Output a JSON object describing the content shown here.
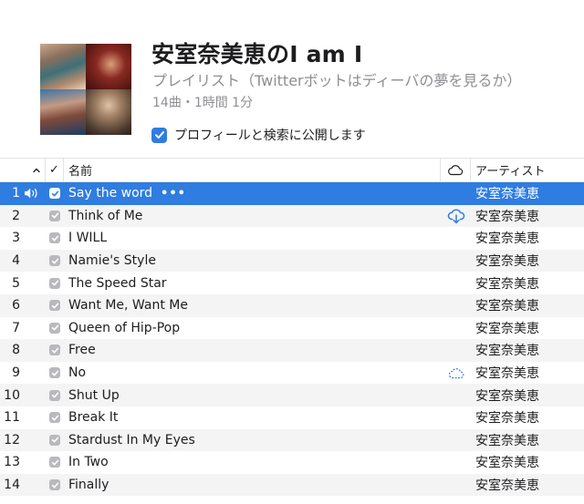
{
  "playlist": {
    "title": "安室奈美恵のI am I",
    "subtitle": "プレイリスト（Twitterボットはディーバの夢を見るか）",
    "meta": "14曲・1時間 1分",
    "publish_label": "プロフィールと検索に公開します",
    "publish_checked": true
  },
  "columns": {
    "sort": "^",
    "check": "✓",
    "name": "名前",
    "cloud": "cloud-icon",
    "artist": "アーティスト"
  },
  "colors": {
    "accent": "#2f7de1",
    "selected_row": "#2f7de1",
    "alt_row": "#f4f4f5",
    "secondary_text": "#8e8e93"
  },
  "tracks": [
    {
      "num": "1",
      "name": "Say the word",
      "artist": "安室奈美恵",
      "selected": true,
      "playing": true,
      "more": "•••"
    },
    {
      "num": "2",
      "name": "Think of Me",
      "artist": "安室奈美恵",
      "cloud": "cloud-download-icon"
    },
    {
      "num": "3",
      "name": "I WILL",
      "artist": "安室奈美恵"
    },
    {
      "num": "4",
      "name": "Namie's Style",
      "artist": "安室奈美恵"
    },
    {
      "num": "5",
      "name": "The Speed Star",
      "artist": "安室奈美恵"
    },
    {
      "num": "6",
      "name": "Want Me, Want Me",
      "artist": "安室奈美恵"
    },
    {
      "num": "7",
      "name": "Queen of Hip-Pop",
      "artist": "安室奈美恵"
    },
    {
      "num": "8",
      "name": "Free",
      "artist": "安室奈美恵"
    },
    {
      "num": "9",
      "name": "No",
      "artist": "安室奈美恵",
      "cloud": "cloud-waiting-icon"
    },
    {
      "num": "10",
      "name": "Shut Up",
      "artist": "安室奈美恵"
    },
    {
      "num": "11",
      "name": "Break It",
      "artist": "安室奈美恵"
    },
    {
      "num": "12",
      "name": "Stardust In My Eyes",
      "artist": "安室奈美恵"
    },
    {
      "num": "13",
      "name": "In Two",
      "artist": "安室奈美恵"
    },
    {
      "num": "14",
      "name": "Finally",
      "artist": "安室奈美恵"
    }
  ]
}
